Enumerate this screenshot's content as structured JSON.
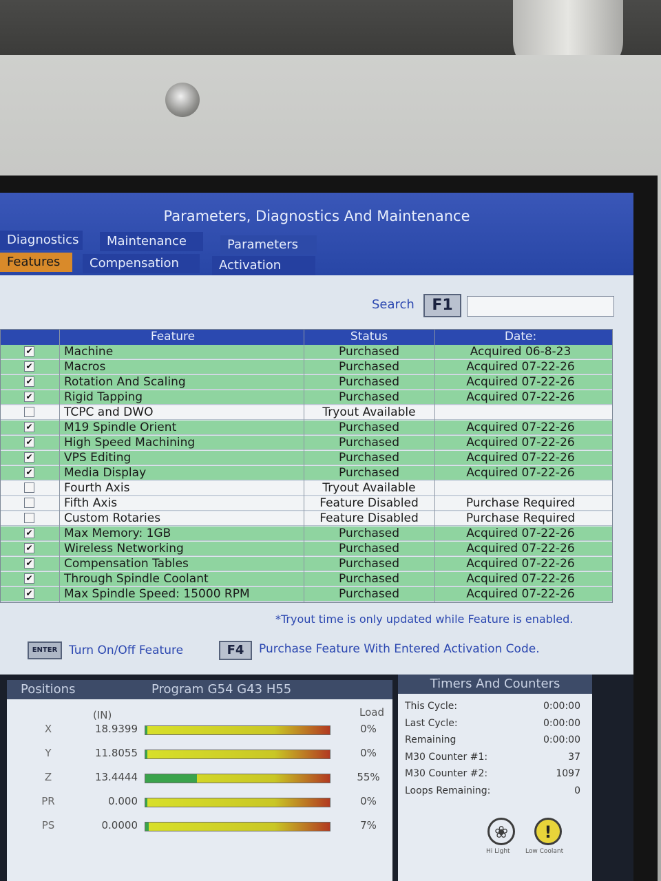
{
  "window": {
    "title": "Parameters, Diagnostics And Maintenance"
  },
  "tabs": {
    "row1": [
      {
        "label": "Diagnostics"
      },
      {
        "label": "Maintenance"
      },
      {
        "label": "Parameters"
      }
    ],
    "row2": [
      {
        "label": "Features",
        "active": true
      },
      {
        "label": "Compensation"
      },
      {
        "label": "Activation"
      }
    ]
  },
  "search": {
    "label": "Search",
    "key": "F1",
    "value": ""
  },
  "table": {
    "headers": {
      "feature": "Feature",
      "status": "Status",
      "date": "Date:"
    },
    "rows": [
      {
        "checked": true,
        "feature": "Machine",
        "status": "Purchased",
        "date": "Acquired 06-8-23"
      },
      {
        "checked": true,
        "feature": "Macros",
        "status": "Purchased",
        "date": "Acquired 07-22-26"
      },
      {
        "checked": true,
        "feature": "Rotation And Scaling",
        "status": "Purchased",
        "date": "Acquired 07-22-26"
      },
      {
        "checked": true,
        "feature": "Rigid Tapping",
        "status": "Purchased",
        "date": "Acquired 07-22-26"
      },
      {
        "checked": false,
        "feature": "TCPC and DWO",
        "status": "Tryout Available",
        "date": ""
      },
      {
        "checked": true,
        "feature": "M19 Spindle Orient",
        "status": "Purchased",
        "date": "Acquired 07-22-26"
      },
      {
        "checked": true,
        "feature": "High Speed Machining",
        "status": "Purchased",
        "date": "Acquired 07-22-26"
      },
      {
        "checked": true,
        "feature": "VPS Editing",
        "status": "Purchased",
        "date": "Acquired 07-22-26"
      },
      {
        "checked": true,
        "feature": "Media Display",
        "status": "Purchased",
        "date": "Acquired 07-22-26"
      },
      {
        "checked": false,
        "feature": "Fourth Axis",
        "status": "Tryout Available",
        "date": ""
      },
      {
        "checked": false,
        "feature": "Fifth Axis",
        "status": "Feature Disabled",
        "date": "Purchase Required"
      },
      {
        "checked": false,
        "feature": "Custom Rotaries",
        "status": "Feature Disabled",
        "date": "Purchase Required"
      },
      {
        "checked": true,
        "feature": "Max Memory: 1GB",
        "status": "Purchased",
        "date": "Acquired 07-22-26"
      },
      {
        "checked": true,
        "feature": "Wireless Networking",
        "status": "Purchased",
        "date": "Acquired 07-22-26"
      },
      {
        "checked": true,
        "feature": "Compensation Tables",
        "status": "Purchased",
        "date": "Acquired 07-22-26"
      },
      {
        "checked": true,
        "feature": "Through Spindle Coolant",
        "status": "Purchased",
        "date": "Acquired 07-22-26"
      },
      {
        "checked": true,
        "feature": "Max Spindle Speed: 15000 RPM",
        "status": "Purchased",
        "date": "Acquired 07-22-26"
      }
    ]
  },
  "footer": {
    "note": "*Tryout time is only updated while Feature is enabled.",
    "enter_key": "ENTER",
    "enter_hint": "Turn On/Off Feature",
    "f4_key": "F4",
    "f4_hint": "Purchase Feature With Entered Activation Code."
  },
  "positions": {
    "title": "Positions",
    "program": "Program G54 G43 H55",
    "unit": "(IN)",
    "load_label": "Load",
    "axes": [
      {
        "axis": "X",
        "value": "18.9399",
        "load": "0%",
        "load_frac": 0.0
      },
      {
        "axis": "Y",
        "value": "11.8055",
        "load": "0%",
        "load_frac": 0.0
      },
      {
        "axis": "Z",
        "value": "13.4444",
        "load": "55%",
        "load_frac": 0.28
      },
      {
        "axis": "PR",
        "value": "0.000",
        "load": "0%",
        "load_frac": 0.0
      },
      {
        "axis": "PS",
        "value": "0.0000",
        "load": "7%",
        "load_frac": 0.02
      }
    ]
  },
  "timers": {
    "title": "Timers And Counters",
    "items": [
      {
        "label": "This Cycle:",
        "value": "0:00:00"
      },
      {
        "label": "Last Cycle:",
        "value": "0:00:00"
      },
      {
        "label": "Remaining",
        "value": "0:00:00"
      },
      {
        "label": "M30 Counter #1:",
        "value": "37"
      },
      {
        "label": "M30 Counter #2:",
        "value": "1097"
      },
      {
        "label": "Loops Remaining:",
        "value": "0"
      }
    ],
    "status_icons": [
      {
        "icon": "lightbulb-icon",
        "label": "Hi Light"
      },
      {
        "icon": "warning-icon",
        "label": "Low Coolant"
      }
    ]
  }
}
